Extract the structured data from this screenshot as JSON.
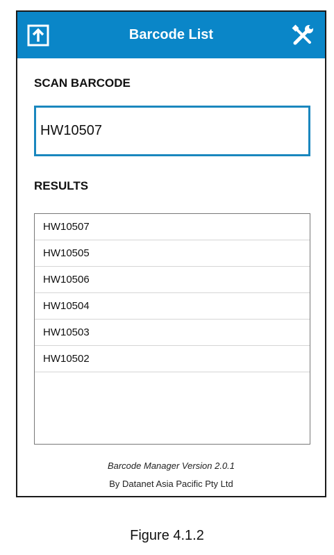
{
  "app_bar": {
    "title": "Barcode List",
    "color": "#0a86c8",
    "left_icon": "export-icon",
    "right_icon": "wrench-screwdriver-icon"
  },
  "scan": {
    "label": "SCAN BARCODE",
    "value": "HW10507",
    "border_color": "#1a87be"
  },
  "results": {
    "label": "RESULTS",
    "items": [
      "HW10507",
      "HW10505",
      "HW10506",
      "HW10504",
      "HW10503",
      "HW10502"
    ]
  },
  "footer": {
    "version": "Barcode Manager Version 2.0.1",
    "company": "By Datanet Asia Pacific Pty Ltd"
  },
  "caption": "Figure 4.1.2"
}
